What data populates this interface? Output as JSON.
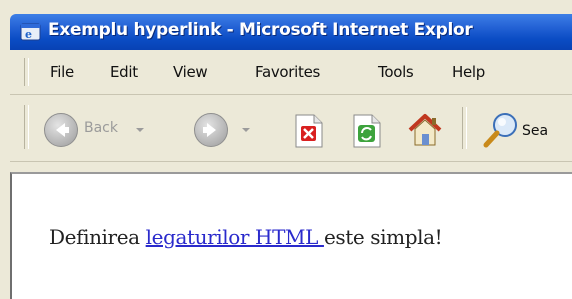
{
  "window": {
    "title": "Exemplu hyperlink - Microsoft Internet Explor"
  },
  "menu": {
    "items": [
      {
        "label": "File"
      },
      {
        "label": "Edit"
      },
      {
        "label": "View"
      },
      {
        "label": "Favorites"
      },
      {
        "label": "Tools"
      },
      {
        "label": "Help"
      }
    ]
  },
  "toolbar": {
    "back_label": "Back",
    "search_label": "Sea",
    "icons": [
      "back-arrow-icon",
      "forward-arrow-icon",
      "stop-icon",
      "refresh-icon",
      "home-icon",
      "search-icon"
    ]
  },
  "page": {
    "text_before": "Definirea ",
    "link_text": "legaturilor HTML ",
    "text_after": "este simpla!"
  },
  "colors": {
    "titlebar": "#0a4cc4",
    "link": "#2a2acc",
    "chrome": "#ece9d8"
  }
}
